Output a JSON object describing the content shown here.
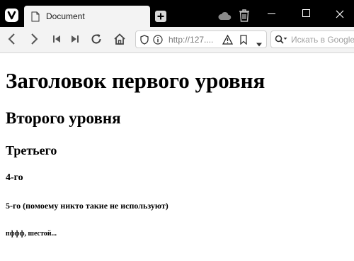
{
  "browser": {
    "tab": {
      "title": "Document"
    },
    "address": {
      "url": "http://127...."
    },
    "search": {
      "placeholder": "Искать в Google"
    }
  },
  "page": {
    "h1": "Заголовок первого уровня",
    "h2": "Второго уровня",
    "h3": "Третьего",
    "h4": "4-го",
    "h5": "5-го (помоему никто такие не используют)",
    "h6": "пффф, шестой..."
  },
  "icons": {
    "titlebar": [
      "vivaldi-logo-icon",
      "document-icon",
      "new-tab-icon",
      "cloud-icon",
      "trash-icon",
      "minimize-icon",
      "maximize-icon",
      "close-icon"
    ],
    "toolbar": [
      "back-icon",
      "forward-icon",
      "rewind-icon",
      "fast-forward-icon",
      "reload-icon",
      "home-icon",
      "shield-icon",
      "info-icon",
      "warning-icon",
      "bookmark-icon",
      "dropdown-icon",
      "search-icon"
    ]
  }
}
